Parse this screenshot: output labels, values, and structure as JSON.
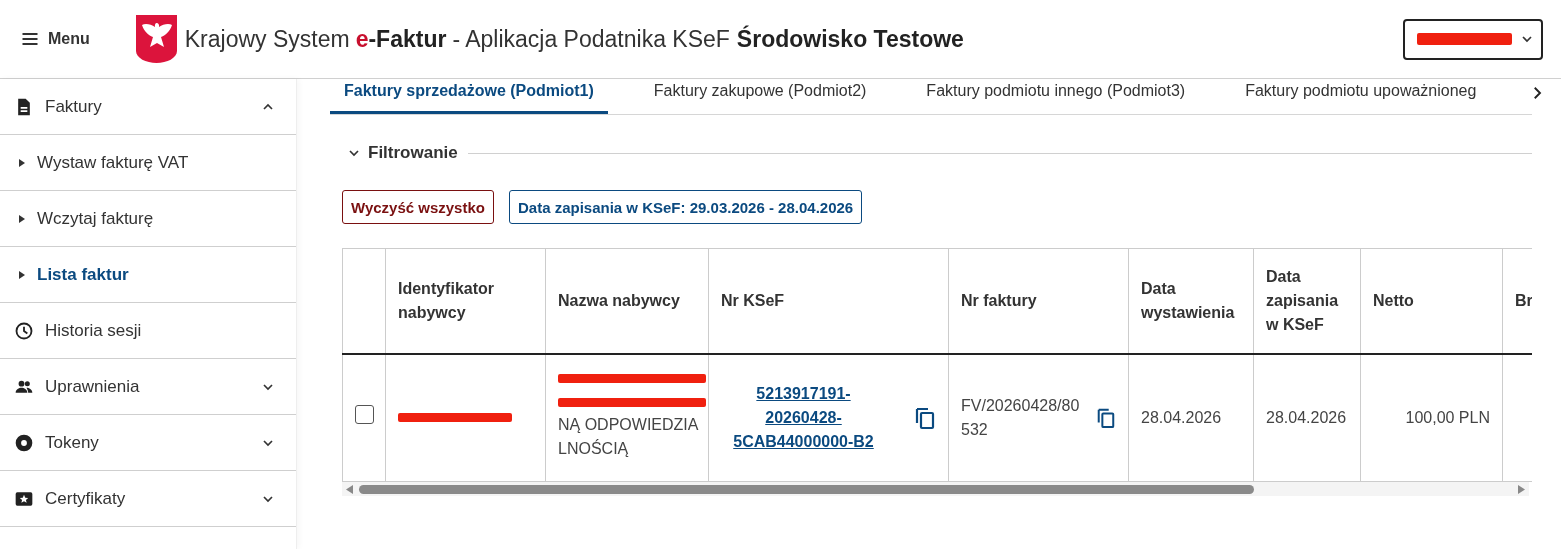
{
  "header": {
    "menu_label": "Menu",
    "title_prefix": "Krajowy System",
    "title_brand_mark": "e",
    "title_brand": "-Faktur",
    "title_suffix": " - Aplikacja Podatnika KSeF",
    "environment": "Środowisko Testowe",
    "account_select": {
      "redacted": true
    }
  },
  "sidebar": {
    "items": [
      {
        "label": "Faktury",
        "expanded": true,
        "children": [
          {
            "label": "Wystaw fakturę VAT",
            "selected": false
          },
          {
            "label": "Wczytaj fakturę",
            "selected": false
          },
          {
            "label": "Lista faktur",
            "selected": true
          }
        ]
      },
      {
        "label": "Historia sesji"
      },
      {
        "label": "Uprawnienia",
        "expanded": false
      },
      {
        "label": "Tokeny",
        "expanded": false
      },
      {
        "label": "Certyfikaty",
        "expanded": false
      }
    ]
  },
  "tabs": [
    {
      "label": "Faktury sprzedażowe (Podmiot1)",
      "selected": true
    },
    {
      "label": "Faktury zakupowe (Podmiot2)",
      "selected": false
    },
    {
      "label": "Faktury podmiotu innego (Podmiot3)",
      "selected": false
    },
    {
      "label": "Faktury podmiotu upoważnioneg",
      "selected": false
    }
  ],
  "filter": {
    "title": "Filtrowanie",
    "expanded": true,
    "chips": [
      {
        "kind": "clear",
        "label": "Wyczyść wszystko"
      },
      {
        "kind": "filter",
        "label": "Data zapisania w KSeF: 29.03.2026 - 28.04.2026"
      }
    ]
  },
  "table": {
    "columns": [
      "Identyfikator nabywcy",
      "Nazwa nabywcy",
      "Nr KSeF",
      "Nr faktury",
      "Data wystawienia",
      "Data zapisania w KSeF",
      "Netto",
      "Br"
    ],
    "rows": [
      {
        "checked": false,
        "buyer_id_redacted": true,
        "buyer_name_redacted": true,
        "buyer_name": "NĄ ODPOWIEDZIALNOŚCIĄ",
        "ksef_number": "5213917191-20260428-5CAB44000000-B2",
        "invoice_number": "FV/20260428/80532",
        "issue_date": "28.04.2026",
        "saved_date": "28.04.2026",
        "net": "100,00 PLN"
      }
    ]
  }
}
